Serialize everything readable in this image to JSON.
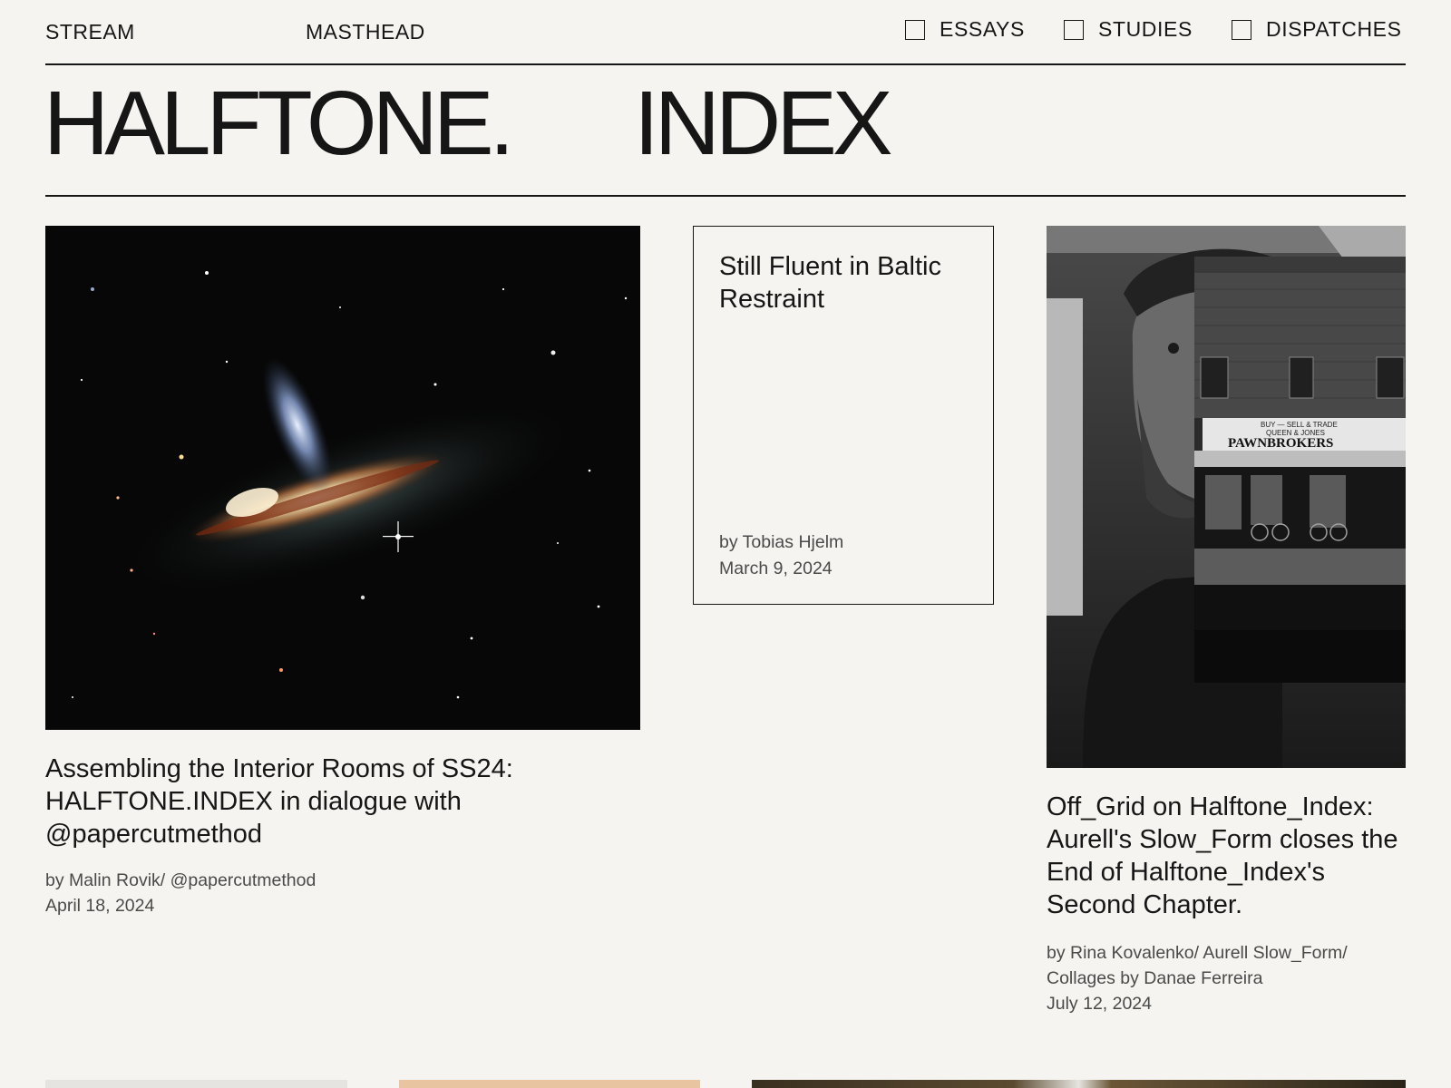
{
  "nav": {
    "stream": "STREAM",
    "masthead": "MASTHEAD"
  },
  "filters": [
    {
      "label": "ESSAYS",
      "checked": false
    },
    {
      "label": "STUDIES",
      "checked": false
    },
    {
      "label": "DISPATCHES",
      "checked": false
    }
  ],
  "logo": {
    "part1": "HALFTONE.",
    "part2": "INDEX"
  },
  "articles": [
    {
      "title": "Assembling the Interior Rooms of SS24: HALFTONE.INDEX in dialogue with @papercutmethod",
      "byline": "by Malin Rovik/ @papercutmethod",
      "date": "April 18, 2024"
    },
    {
      "title": "Still Fluent in Baltic Restraint",
      "byline": "by Tobias Hjelm",
      "date": "March 9, 2024"
    },
    {
      "title": "Off_Grid on Halftone_Index: Aurell's Slow_Form closes the End of Halftone_Index's Second Chapter.",
      "byline": "by Rina Kovalenko/ Aurell Slow_Form/ Collages by Danae Ferreira",
      "date": "July 12, 2024"
    }
  ],
  "collage_sign": {
    "top": "BUY — SELL & TRADE",
    "name": "QUEEN & JONES",
    "main": "PAWNBROKERS"
  },
  "colors": {
    "background": "#f5f4f0",
    "ink": "#161616",
    "meta": "#4a4a4a"
  }
}
